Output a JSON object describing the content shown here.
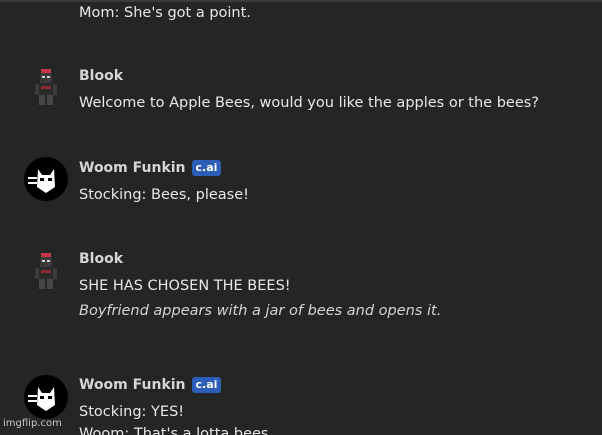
{
  "messages": [
    {
      "lines": [
        "Mom: She's got a point."
      ]
    },
    {
      "name": "Blook",
      "avatar": "roblox-character-avatar",
      "lines": [
        "Welcome to Apple Bees, would you like the apples or the bees?"
      ]
    },
    {
      "name": "Woom Funkin",
      "badge": "c.ai",
      "avatar": "white-cat-face-avatar",
      "lines": [
        "Stocking: Bees, please!"
      ]
    },
    {
      "name": "Blook",
      "avatar": "roblox-character-avatar",
      "lines": [
        "SHE HAS CHOSEN THE BEES!"
      ],
      "italic_lines": [
        "Boyfriend appears with a jar of bees and opens it."
      ]
    },
    {
      "name": "Woom Funkin",
      "badge": "c.ai",
      "avatar": "white-cat-face-avatar",
      "lines": [
        "Stocking: YES!",
        "Woom: That's a lotta bees."
      ]
    }
  ],
  "watermark": "imgflip.com",
  "colors": {
    "background": "#242525",
    "badge": "#2c5eb8",
    "name": "#d6d6d6",
    "text": "#e8e8e8"
  }
}
